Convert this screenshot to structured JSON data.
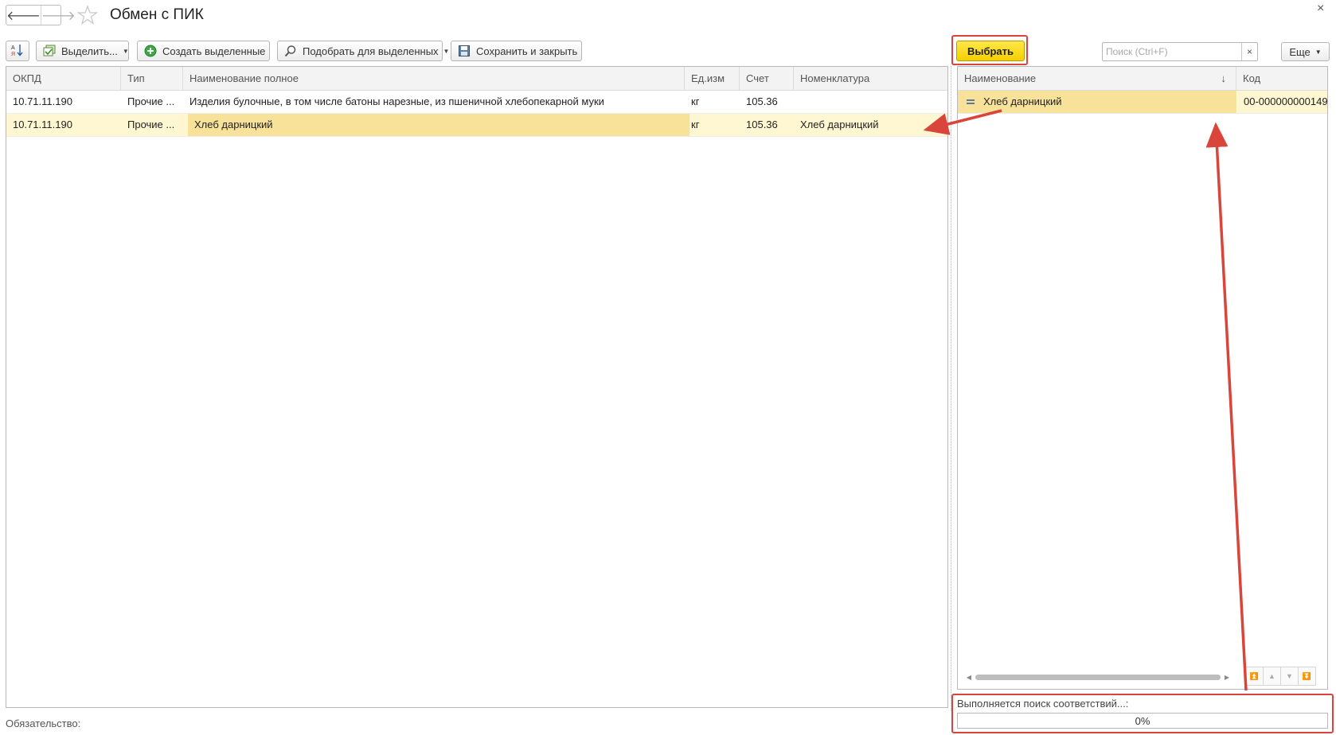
{
  "window": {
    "title": "Обмен с ПИК",
    "back_icon": "arrow-left-icon",
    "forward_icon": "arrow-right-icon",
    "favorite_icon": "star-icon",
    "close_icon": "close-icon"
  },
  "toolbar": {
    "sort_icon": "sort-icon",
    "select_label": "Выделить...",
    "create_label": "Создать выделенные",
    "pick_label": "Подобрать для выделенных",
    "save_close_label": "Сохранить и закрыть",
    "choose_label": "Выбрать"
  },
  "search": {
    "placeholder": "Поиск (Ctrl+F)",
    "value": "",
    "clear": "×"
  },
  "more_label": "Еще",
  "main_table": {
    "columns": [
      "ОКПД",
      "Тип",
      "Наименование полное",
      "Ед.изм",
      "Счет",
      "Номенклатура"
    ],
    "rows": [
      [
        "10.71.11.190",
        "Прочие ...",
        "Изделия булочные, в том числе батоны нарезные, из пшеничной хлебопекарной муки",
        "кг",
        "105.36",
        ""
      ],
      [
        "10.71.11.190",
        "Прочие ...",
        "Хлеб дарницкий",
        "кг",
        "105.36",
        "Хлеб дарницкий"
      ]
    ],
    "selected_row": 1
  },
  "right_table": {
    "columns": [
      "Наименование",
      "Код"
    ],
    "sort_indicator": "↓",
    "rows": [
      [
        "Хлеб дарницкий",
        "00-000000000149"
      ]
    ]
  },
  "progress": {
    "label": "Выполняется поиск соответствий...:",
    "text": "0%",
    "value": 0
  },
  "footer": {
    "label": "Обязательство:"
  },
  "colors": {
    "accent_yellow": "#f5cf00",
    "selected_row": "#fff7d1",
    "focused_cell": "#f8e29a",
    "annotation_red": "#d9453a"
  }
}
